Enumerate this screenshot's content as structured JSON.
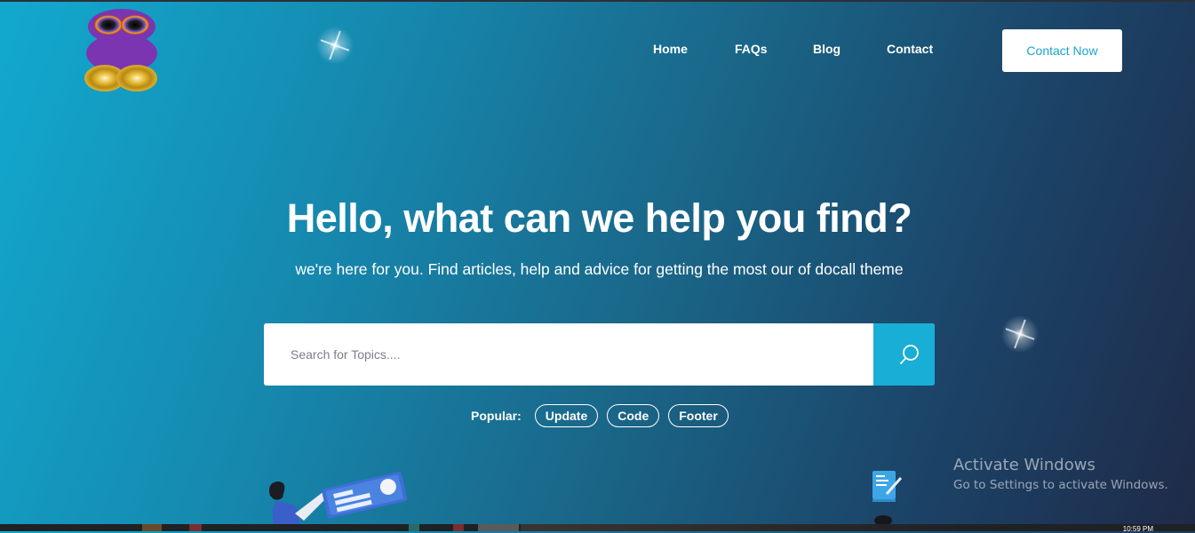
{
  "brand": {
    "logo": "docall-logo"
  },
  "nav": {
    "items": [
      {
        "label": "Home"
      },
      {
        "label": "FAQs"
      },
      {
        "label": "Blog"
      },
      {
        "label": "Contact"
      }
    ],
    "cta_label": "Contact Now"
  },
  "hero": {
    "title": "Hello, what can we help you find?",
    "subtitle": "we're here for you. Find articles, help and advice for getting the most our of docall theme"
  },
  "search": {
    "placeholder": "Search for Topics....",
    "value": "",
    "button_icon": "search-icon"
  },
  "popular": {
    "label": "Popular:",
    "tags": [
      {
        "label": "Update"
      },
      {
        "label": "Code"
      },
      {
        "label": "Footer"
      }
    ]
  },
  "watermark": {
    "title": "Activate Windows",
    "subtitle": "Go to Settings to activate Windows."
  },
  "taskbar": {
    "clock": "10:59 PM"
  },
  "colors": {
    "accent": "#19aed6",
    "text": "#ffffff",
    "logo_purple": "#7b35b0",
    "logo_gold": "#d9a418"
  }
}
